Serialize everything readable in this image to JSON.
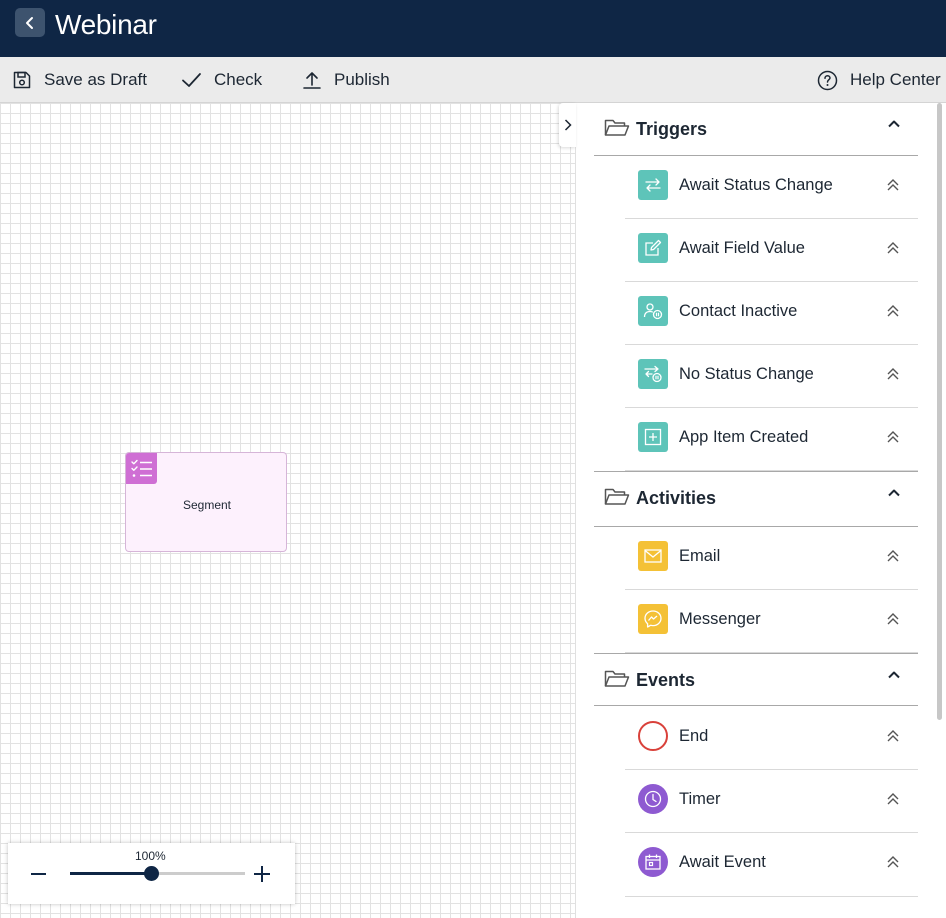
{
  "header": {
    "title": "Webinar"
  },
  "toolbar": {
    "save_draft": "Save as Draft",
    "check": "Check",
    "publish": "Publish",
    "help": "Help Center"
  },
  "canvas": {
    "node": {
      "label": "Segment",
      "icon": "checklist-icon",
      "color": "#cf6fd4"
    },
    "zoom": {
      "label": "100%",
      "value": 0.46
    }
  },
  "panel": {
    "groups": [
      {
        "title": "Triggers",
        "items": [
          {
            "label": "Await Status Change",
            "icon": "swap-arrows-icon",
            "color": "#5ec4b9"
          },
          {
            "label": "Await Field Value",
            "icon": "edit-field-icon",
            "color": "#5ec4b9"
          },
          {
            "label": "Contact Inactive",
            "icon": "user-pause-icon",
            "color": "#5ec4b9"
          },
          {
            "label": "No Status Change",
            "icon": "swap-pause-icon",
            "color": "#5ec4b9"
          },
          {
            "label": "App Item Created",
            "icon": "plus-square-icon",
            "color": "#5ec4b9"
          }
        ]
      },
      {
        "title": "Activities",
        "items": [
          {
            "label": "Email",
            "icon": "envelope-icon",
            "color": "#f4c136"
          },
          {
            "label": "Messenger",
            "icon": "messenger-icon",
            "color": "#f4c136"
          }
        ]
      },
      {
        "title": "Events",
        "items": [
          {
            "label": "End",
            "icon": "end-circle-icon",
            "color": "#d9413a"
          },
          {
            "label": "Timer",
            "icon": "clock-icon",
            "color": "#8e5ad1"
          },
          {
            "label": "Await Event",
            "icon": "calendar-icon",
            "color": "#8e5ad1"
          }
        ]
      }
    ]
  }
}
